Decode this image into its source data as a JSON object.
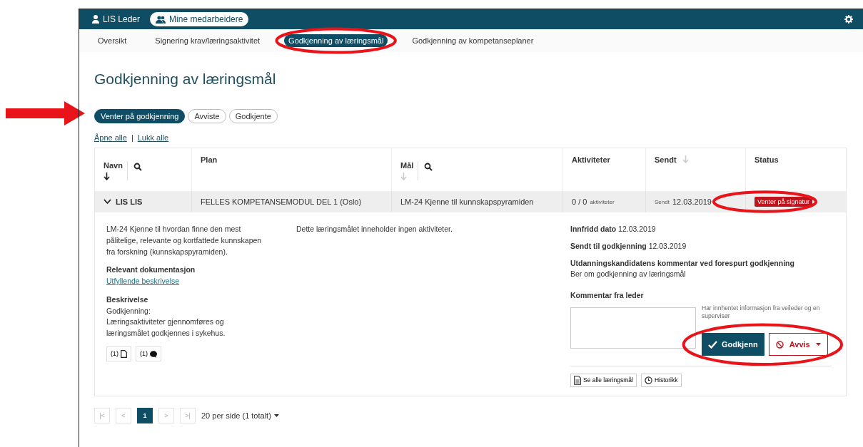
{
  "header": {
    "user": "LIS Leder",
    "team_button": "Mine medarbeidere"
  },
  "subnav": [
    {
      "label": "Oversikt",
      "selected": false
    },
    {
      "label": "Signering krav/læringsaktivitet",
      "selected": false
    },
    {
      "label": "Godkjenning av læringsmål",
      "selected": true
    },
    {
      "label": "Godkjenning av kompetanseplaner",
      "selected": false
    }
  ],
  "title": "Godkjenning av læringsmål",
  "filters": [
    {
      "label": "Venter på godkjenning",
      "selected": true
    },
    {
      "label": "Avviste",
      "selected": false
    },
    {
      "label": "Godkjente",
      "selected": false
    }
  ],
  "expand_links": [
    "Åpne alle",
    "Lukk alle"
  ],
  "expand_separator": "|",
  "table": {
    "columns": [
      {
        "label": "Navn",
        "sort_active": true,
        "search": true
      },
      {
        "label": "Plan"
      },
      {
        "label": "Mål",
        "sort_active": false,
        "search": true
      },
      {
        "label": "Aktiviteter"
      },
      {
        "label": "Sendt",
        "sort_active": false
      },
      {
        "label": "Status"
      }
    ],
    "rows": [
      {
        "name": "LIS LIS",
        "expanded": true,
        "plan": "FELLES KOMPETANSEMODUL DEL 1 (Oslo)",
        "goal": "LM-24 Kjenne til kunnskapspyramiden",
        "activities": "0 / 0",
        "activities_unit": "aktiviteter",
        "sent_label": "Sendt",
        "sent": "12.03.2019",
        "status": "Venter på signatur",
        "detail": {
          "description": "LM-24 Kjenne til hvordan finne den mest pålitelige, relevante og kortfattede kunnskapen fra forskning (kunnskapspyramiden).",
          "doc_heading": "Relevant dokumentasjon",
          "doc_link": "Utfyllende beskrivelse",
          "desc_heading": "Beskrivelse",
          "desc_lines": [
            "Godkjenning:",
            "Læringsaktiviteter gjennomføres og læringsmålet godkjennes i sykehus."
          ],
          "attachments": [
            {
              "kind": "document",
              "count": "(1)"
            },
            {
              "kind": "comment",
              "count": "(1)"
            }
          ],
          "activities_text": "Dette læringsmålet inneholder ingen aktiviteter.",
          "facts": [
            {
              "label": "Innfridd dato",
              "value": "12.03.2019"
            },
            {
              "label": "Sendt til godkjenning",
              "value": "12.03.2019"
            }
          ],
          "candidate_comment_heading": "Utdanningskandidatens kommentar ved forespurt godkjenning",
          "candidate_comment": "Ber om godkjenning av læringsmål",
          "leader_comment_label": "Kommentar fra leder",
          "hint": "Har innhentet informasjon fra veileder og en supervisør",
          "approve": "Godkjenn",
          "reject": "Avvis",
          "footer_buttons": [
            {
              "kind": "goals",
              "label": "Se alle læringsmål"
            },
            {
              "kind": "history",
              "label": "Historikk"
            }
          ]
        }
      }
    ]
  },
  "pagination": {
    "pages": [
      {
        "label": "|<",
        "selected": false
      },
      {
        "label": "<",
        "selected": false
      },
      {
        "label": "1",
        "selected": true
      },
      {
        "label": ">",
        "selected": false
      },
      {
        "label": ">|",
        "selected": false
      }
    ],
    "summary": "20 per side (1 totalt)"
  }
}
